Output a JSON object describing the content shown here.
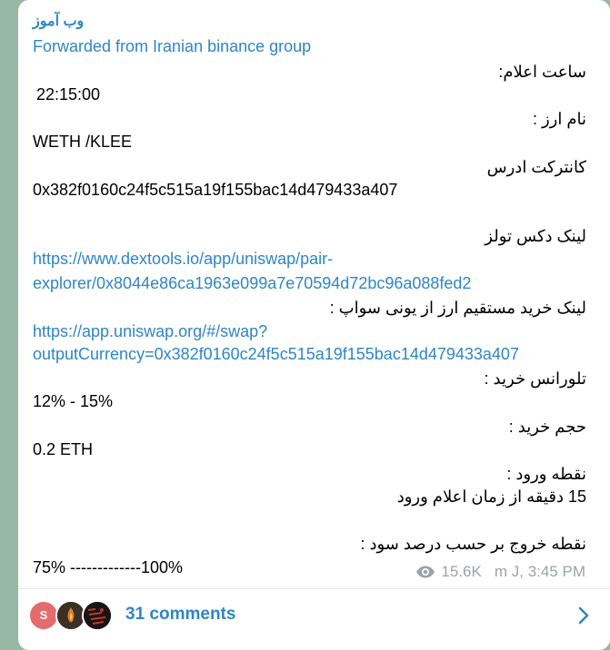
{
  "channel_name": "وب آموز",
  "forwarded_from": "Forwarded from Iranian binance group",
  "message": {
    "announce_time_label": "ساعت اعلام:",
    "announce_time_value": "22:15:00",
    "token_name_label": "نام ارز :",
    "token_name_value": "WETH /KLEE",
    "contract_label": "کانترکت ادرس",
    "contract_value": "0x382f0160c24f5c515a19f155bac14d479433a407",
    "dextools_label": "لینک دکس تولز",
    "dextools_link_line1": "https://www.dextools.io/app/uniswap/pair-",
    "dextools_link_line2": "explorer/0x8044e86ca1963e099a7e70594d72bc96a088fed2",
    "uniswap_label": "لینک خرید مستقیم ارز از یونی سواپ :",
    "uniswap_link_line1": "https://app.uniswap.org/#/swap?",
    "uniswap_link_line2": "outputCurrency=0x382f0160c24f5c515a19f155bac14d479433a407",
    "tolerance_label": "تلورانس خرید :",
    "tolerance_value": "12% - 15%",
    "volume_label": "حجم خرید :",
    "volume_value": "0.2 ETH",
    "entry_label": "نقطه ورود :",
    "entry_value": "15 دقیقه از زمان اعلام ورود",
    "exit_label": "نقطه خروج بر حسب درصد سود :",
    "exit_value": "75% -------------100%"
  },
  "meta": {
    "views": "15.6K",
    "author_time": "m J, 3:45 PM",
    "icon": "eye-icon"
  },
  "footer": {
    "avatar_initial": "S",
    "comments_label": "31 comments",
    "icon": "chevron-right-icon",
    "colors": {
      "accent": "#2f86c5",
      "avatar_s": "#e56b6f"
    }
  }
}
